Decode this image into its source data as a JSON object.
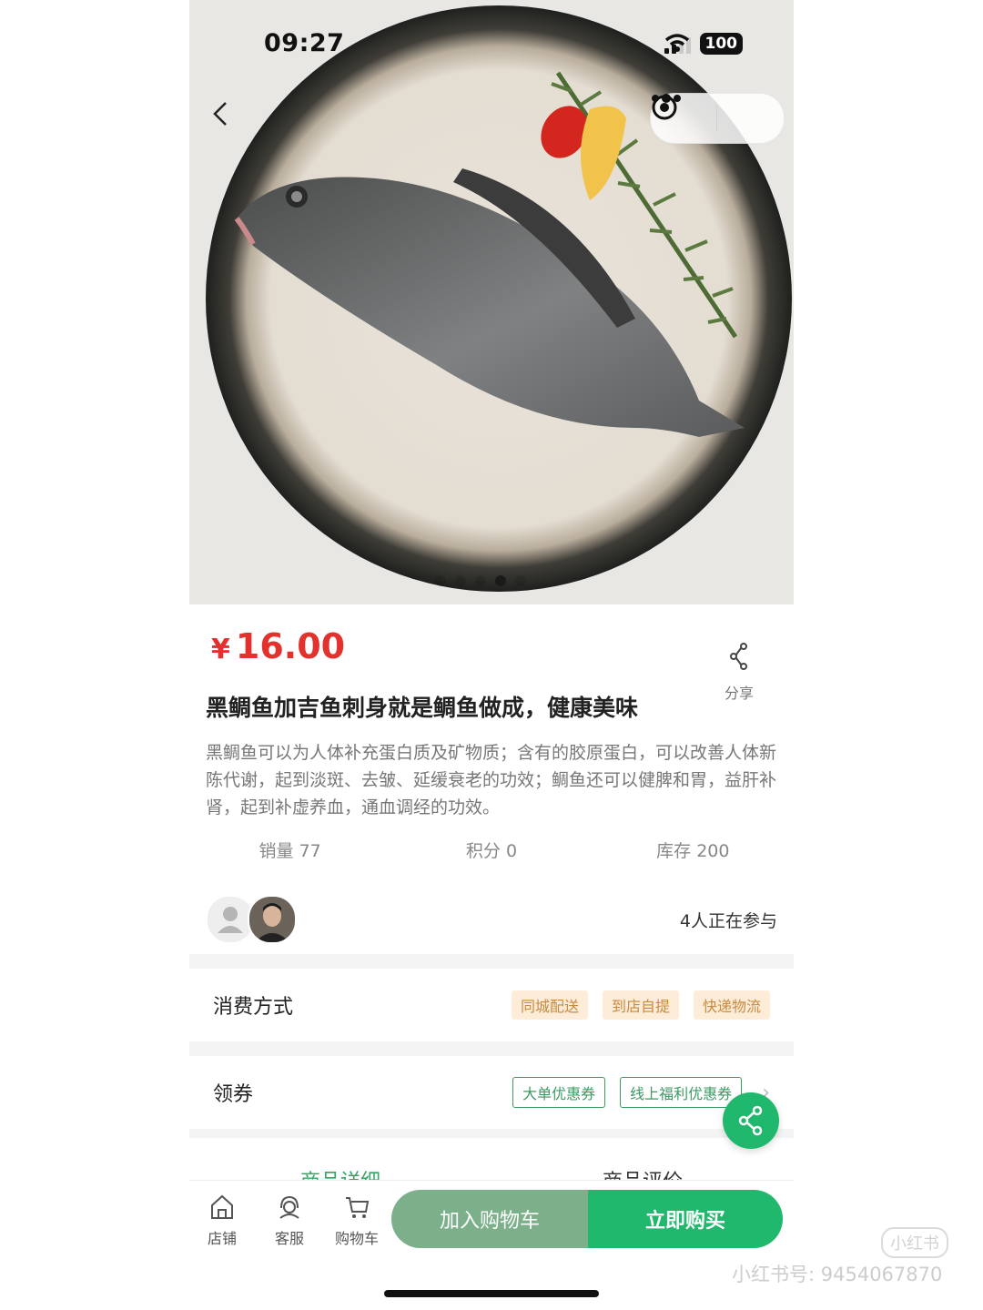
{
  "status_bar": {
    "time": "09:27",
    "battery": "100"
  },
  "product": {
    "currency": "¥",
    "price": "16.00",
    "title": "黑鲷鱼加吉鱼刺身就是鲷鱼做成，健康美味",
    "description": "黑鲷鱼可以为人体补充蛋白质及矿物质；含有的胶原蛋白，可以改善人体新陈代谢，起到淡斑、去皱、延缓衰老的功效；鲷鱼还可以健脾和胃，益肝补肾，起到补虚养血，通血调经的功效。",
    "share_label": "分享",
    "carousel": {
      "count": 5,
      "active_index": 3
    }
  },
  "stats": {
    "sales": "销量 77",
    "points": "积分 0",
    "stock": "库存 200"
  },
  "participants": {
    "text": "4人正在参与"
  },
  "consumption": {
    "label": "消费方式",
    "tags": [
      "同城配送",
      "到店自提",
      "快递物流"
    ]
  },
  "coupons": {
    "label": "领券",
    "tags": [
      "大单优惠券",
      "线上福利优惠券"
    ]
  },
  "tabs": [
    "商品详细",
    "商品评价"
  ],
  "bottom_nav": {
    "store": "店铺",
    "service": "客服",
    "cart": "购物车",
    "add_to_cart": "加入购物车",
    "buy_now": "立即购买"
  },
  "watermark": {
    "logo": "小红书",
    "text": "小红书号: 9454067870"
  },
  "colors": {
    "price": "#e3322d",
    "primary_green": "#1fb86c",
    "muted_green": "#7bb08a",
    "tag_orange_bg": "#fdecd8",
    "tag_orange_text": "#c98a3e"
  }
}
